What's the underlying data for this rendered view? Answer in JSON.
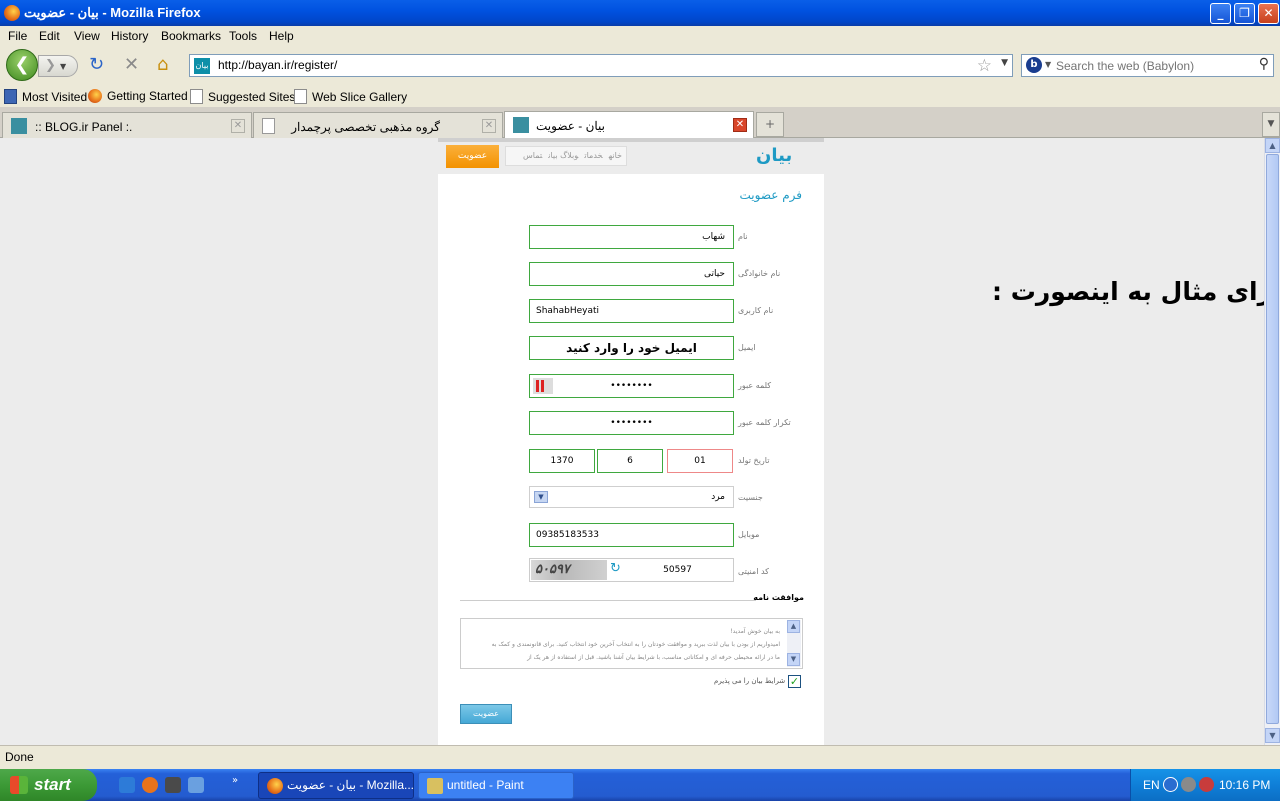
{
  "window": {
    "title": "بیان - عضویت - Mozilla Firefox"
  },
  "menu": [
    "File",
    "Edit",
    "View",
    "History",
    "Bookmarks",
    "Tools",
    "Help"
  ],
  "nav": {
    "url": "http://bayan.ir/register/",
    "search_placeholder": "Search the web (Babylon)",
    "site_icon_text": "بیان"
  },
  "bookmarks": [
    "Most Visited",
    "Getting Started",
    "Suggested Sites",
    "Web Slice Gallery"
  ],
  "tabs": [
    {
      "label": ":: BLOG.ir Panel :."
    },
    {
      "label": "گروه مذهبی تخصصی پرچمدار"
    },
    {
      "label": "بیان - عضویت"
    }
  ],
  "page": {
    "logo": "بیان",
    "top_nav": [
      "خانه",
      "خدمات",
      "وبلاگ بیان",
      "تماس"
    ],
    "join_button": "عضویت",
    "form_title": "فرم عضویت",
    "fields": {
      "name": {
        "label": "نام",
        "value": "شهاب"
      },
      "family": {
        "label": "نام خانوادگی",
        "value": "حیاتی"
      },
      "username": {
        "label": "نام کاربری",
        "value": "ShahabHeyati"
      },
      "email": {
        "label": "ایمیل",
        "value": "ایمیل خود را وارد کنید"
      },
      "password": {
        "label": "کلمه عبور",
        "value": "••••••••"
      },
      "password_repeat": {
        "label": "تکرار کلمه عبور",
        "value": "••••••••"
      },
      "birthdate": {
        "label": "تاریخ تولد",
        "year": "1370",
        "month": "6",
        "day": "01"
      },
      "gender": {
        "label": "جنسیت",
        "value": "مرد"
      },
      "mobile": {
        "label": "موبایل",
        "value": "09385183533"
      },
      "captcha": {
        "label": "کد امنیتی",
        "image_text": "۵۰۵۹۷",
        "value": "50597"
      }
    },
    "agreement": {
      "title": "موافقت نامه",
      "text_line1": "به بیان خوش آمدید!",
      "text_line2": "امیدواریم از بودن با بیان لذت ببرید و موافقت خودتان را به انتخاب آخرین خود انتخاب کنید. برای قانونمندی و کمک به",
      "text_line3": "ما در ارائه محیطی حرفه ای و امکاناتی مناسب، با شرایط بیان آشنا باشید. قبل از استفاده از هر یک از",
      "accept_label": "شرایط بیان را می پذیرم"
    },
    "submit": "عضویت"
  },
  "annotation": "برای مثال به اینصورت :",
  "status": "Done",
  "taskbar": {
    "start": "start",
    "tasks": [
      "بیان - عضویت - Mozilla...",
      "untitled - Paint"
    ],
    "lang": "EN",
    "clock": "10:16 PM"
  }
}
